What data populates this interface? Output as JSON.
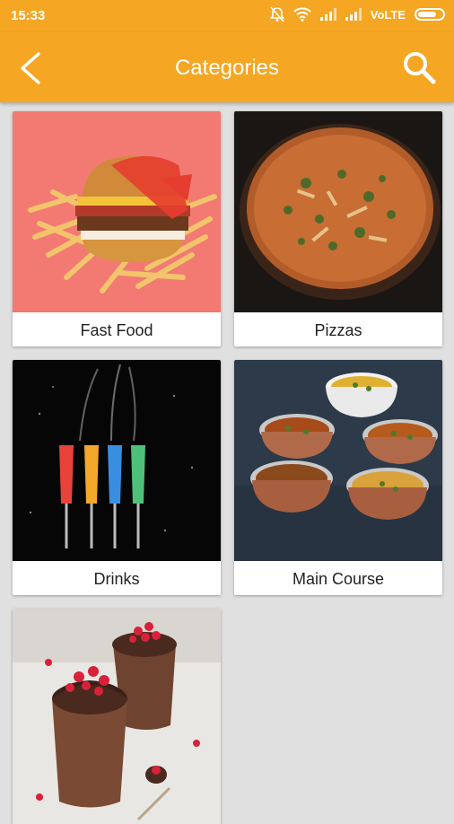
{
  "status_bar": {
    "time": "15:33",
    "network": "VoLTE",
    "icons": [
      "mute-bell-icon",
      "wifi-icon",
      "signal-icon",
      "signal-icon",
      "battery-icon"
    ]
  },
  "app_bar": {
    "title": "Categories",
    "background_color": "#f5a623",
    "back_icon": "back-arrow-icon",
    "search_icon": "search-icon"
  },
  "categories": [
    {
      "label": "Fast Food"
    },
    {
      "label": "Pizzas"
    },
    {
      "label": "Drinks"
    },
    {
      "label": "Main Course"
    },
    {
      "label": ""
    }
  ]
}
